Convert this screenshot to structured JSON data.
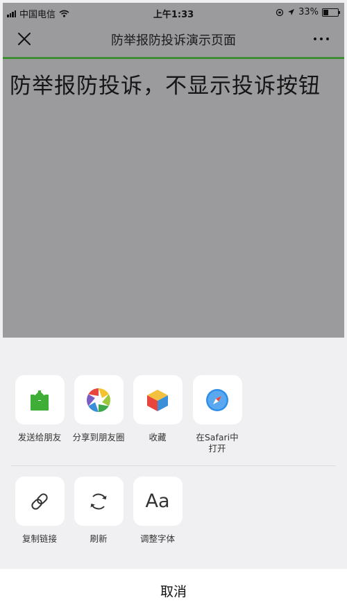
{
  "status_bar": {
    "carrier": "中国电信",
    "time": "上午1:33",
    "battery_text": "33%",
    "battery_level": 0.33
  },
  "nav": {
    "title": "防举报防投诉演示页面",
    "close_icon": "close-icon",
    "more_icon": "more-icon"
  },
  "page": {
    "heading": "防举报防投诉，不显示投诉按钮"
  },
  "action_sheet": {
    "share_row": [
      {
        "label": "发送给朋友",
        "icon": "send-to-friend-icon"
      },
      {
        "label": "分享到朋友圈",
        "icon": "moments-icon"
      },
      {
        "label": "收藏",
        "icon": "favorite-icon"
      },
      {
        "label": "在Safari中打开",
        "icon": "safari-icon"
      }
    ],
    "tool_row": [
      {
        "label": "复制链接",
        "icon": "link-icon"
      },
      {
        "label": "刷新",
        "icon": "refresh-icon"
      },
      {
        "label": "调整字体",
        "icon": "font-icon",
        "glyph": "Aa"
      }
    ],
    "cancel_label": "取消"
  },
  "colors": {
    "progress_green": "#3e8e34",
    "dim_overlay": "#9b9b9e",
    "sheet_bg": "#f0f0f2"
  }
}
